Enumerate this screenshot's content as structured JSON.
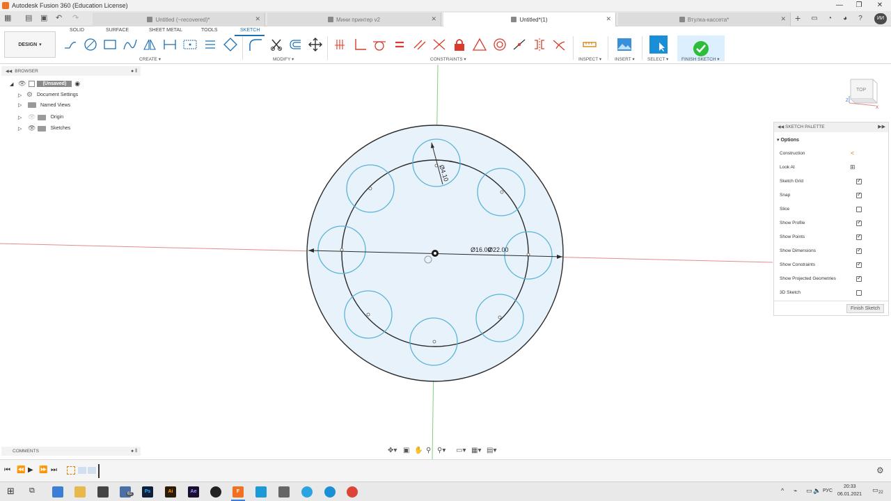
{
  "window": {
    "title": "Autodesk Fusion 360 (Education License)"
  },
  "tabs": [
    {
      "label": "Untitled (~recovered)*",
      "active": false
    },
    {
      "label": "Мини принтер v2",
      "active": false
    },
    {
      "label": "Untitled*(1)",
      "active": true
    },
    {
      "label": "Втулка-кассета*",
      "active": false
    }
  ],
  "user": {
    "initials": "ИИ"
  },
  "toolbar": {
    "mode": "DESIGN",
    "workspace_tabs": [
      "SOLID",
      "SURFACE",
      "SHEET METAL",
      "TOOLS",
      "SKETCH"
    ],
    "active_workspace": "SKETCH",
    "groups": {
      "create": "CREATE",
      "modify": "MODIFY",
      "constraints": "CONSTRAINTS",
      "inspect": "INSPECT",
      "insert": "INSERT",
      "select": "SELECT",
      "finish": "FINISH SKETCH"
    }
  },
  "browser": {
    "title": "BROWSER",
    "items": [
      {
        "label": "(Unsaved)"
      },
      {
        "label": "Document Settings"
      },
      {
        "label": "Named Views"
      },
      {
        "label": "Origin"
      },
      {
        "label": "Sketches"
      }
    ]
  },
  "comments": {
    "title": "COMMENTS"
  },
  "canvas": {
    "dimensions": [
      "Ø4.10",
      "Ø16.00",
      "Ø22.00"
    ],
    "viewcube": "TOP",
    "axis_labels": {
      "x": "X",
      "z": "Z"
    }
  },
  "palette": {
    "title": "SKETCH PALETTE",
    "section": "Options",
    "options": [
      {
        "label": "Construction",
        "type": "icon",
        "icon": "construction-icon"
      },
      {
        "label": "Look At",
        "type": "icon",
        "icon": "look-at-icon"
      },
      {
        "label": "Sketch Grid",
        "type": "checkbox",
        "checked": true
      },
      {
        "label": "Snap",
        "type": "checkbox",
        "checked": true
      },
      {
        "label": "Slice",
        "type": "checkbox",
        "checked": false
      },
      {
        "label": "Show Profile",
        "type": "checkbox",
        "checked": true
      },
      {
        "label": "Show Points",
        "type": "checkbox",
        "checked": true
      },
      {
        "label": "Show Dimensions",
        "type": "checkbox",
        "checked": true
      },
      {
        "label": "Show Constraints",
        "type": "checkbox",
        "checked": true
      },
      {
        "label": "Show Projected Geometries",
        "type": "checkbox",
        "checked": true
      },
      {
        "label": "3D Sketch",
        "type": "checkbox",
        "checked": false
      }
    ],
    "finish_button": "Finish Sketch"
  },
  "taskbar": {
    "lang": "РУС",
    "time": "20:33",
    "date": "06.01.2021",
    "notif_count": "22",
    "badge": "62",
    "apps": [
      "Ps",
      "Ai",
      "Ae"
    ]
  },
  "colors": {
    "accent": "#1a6fb5",
    "profile_fill": "#e8f2fb",
    "circle_blue": "#5ab4d6",
    "finish_green": "#2ebd3a",
    "select_blue": "#1a8fd8"
  }
}
